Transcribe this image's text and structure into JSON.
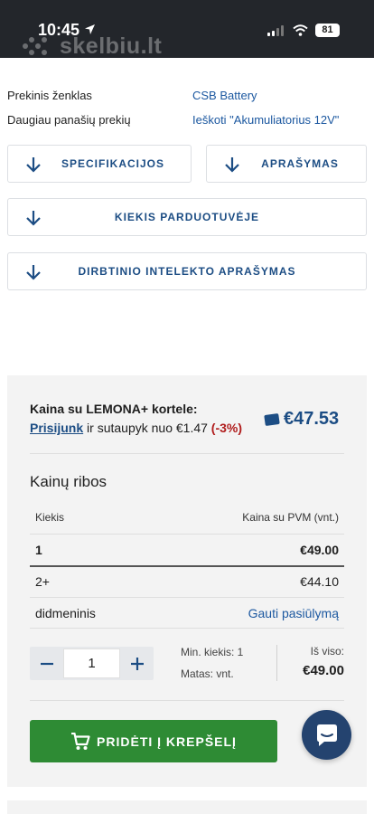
{
  "status_bar": {
    "time": "10:45",
    "battery": "81",
    "watermark": "skelbiu.lt"
  },
  "info": [
    {
      "label": "Prekinis ženklas",
      "value": "CSB Battery"
    },
    {
      "label": "Daugiau panašių prekių",
      "value": "Ieškoti \"Akumuliatorius 12V\""
    }
  ],
  "sections": {
    "specs": "SPECIFIKACIJOS",
    "description": "APRAŠYMAS",
    "stock": "KIEKIS PARDUOTUVĖJE",
    "ai_description": "DIRBTINIO INTELEKTO APRAŠYMAS"
  },
  "lemona": {
    "title": "Kaina su LEMONA+ kortele:",
    "login_link": "Prisijunk",
    "save_text": "ir sutaupyk nuo €1.47",
    "percent": "(-3%)",
    "price": "€47.53"
  },
  "price_ranges": {
    "title": "Kainų ribos",
    "headers": [
      "Kiekis",
      "Kaina su PVM (vnt.)"
    ],
    "rows": [
      {
        "qty": "1",
        "price": "€49.00"
      },
      {
        "qty": "2+",
        "price": "€44.10"
      },
      {
        "qty": "didmeninis",
        "price": "Gauti pasiūlymą"
      }
    ]
  },
  "quantity": {
    "value": "1",
    "min_label": "Min. kiekis: 1",
    "unit_label": "Matas: vnt.",
    "total_label": "Iš viso:",
    "total": "€49.00"
  },
  "cart_button": "PRIDĖTI Į KREPŠELĮ",
  "colors": {
    "accent": "#1c4d84",
    "cart_green": "#2e8b34",
    "discount_red": "#b01c1c",
    "chat": "#24436f"
  }
}
